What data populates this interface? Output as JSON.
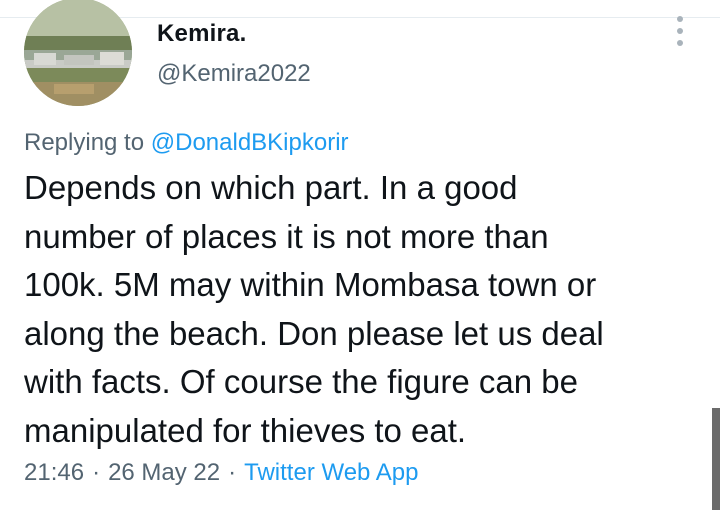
{
  "tweet": {
    "author": {
      "display_name": "Kemira.",
      "handle": "@Kemira2022"
    },
    "replying_to": {
      "prefix": "Replying to",
      "handle": "@DonaldBKipkorir"
    },
    "text_lines": [
      "Depends on which part. In a good",
      "number of places it is not more than",
      "100k. 5M may within Mombasa town or",
      "along the beach. Don please let us deal",
      "with facts. Of course the figure can be",
      "manipulated for thieves to eat."
    ],
    "meta": {
      "time": "21:46",
      "date": "26 May 22",
      "separator": "·",
      "source": "Twitter Web App"
    },
    "menu_icon": "more-vertical-icon"
  },
  "colors": {
    "text_primary": "#0f1419",
    "text_secondary": "#536471",
    "link": "#1d9bf0"
  }
}
